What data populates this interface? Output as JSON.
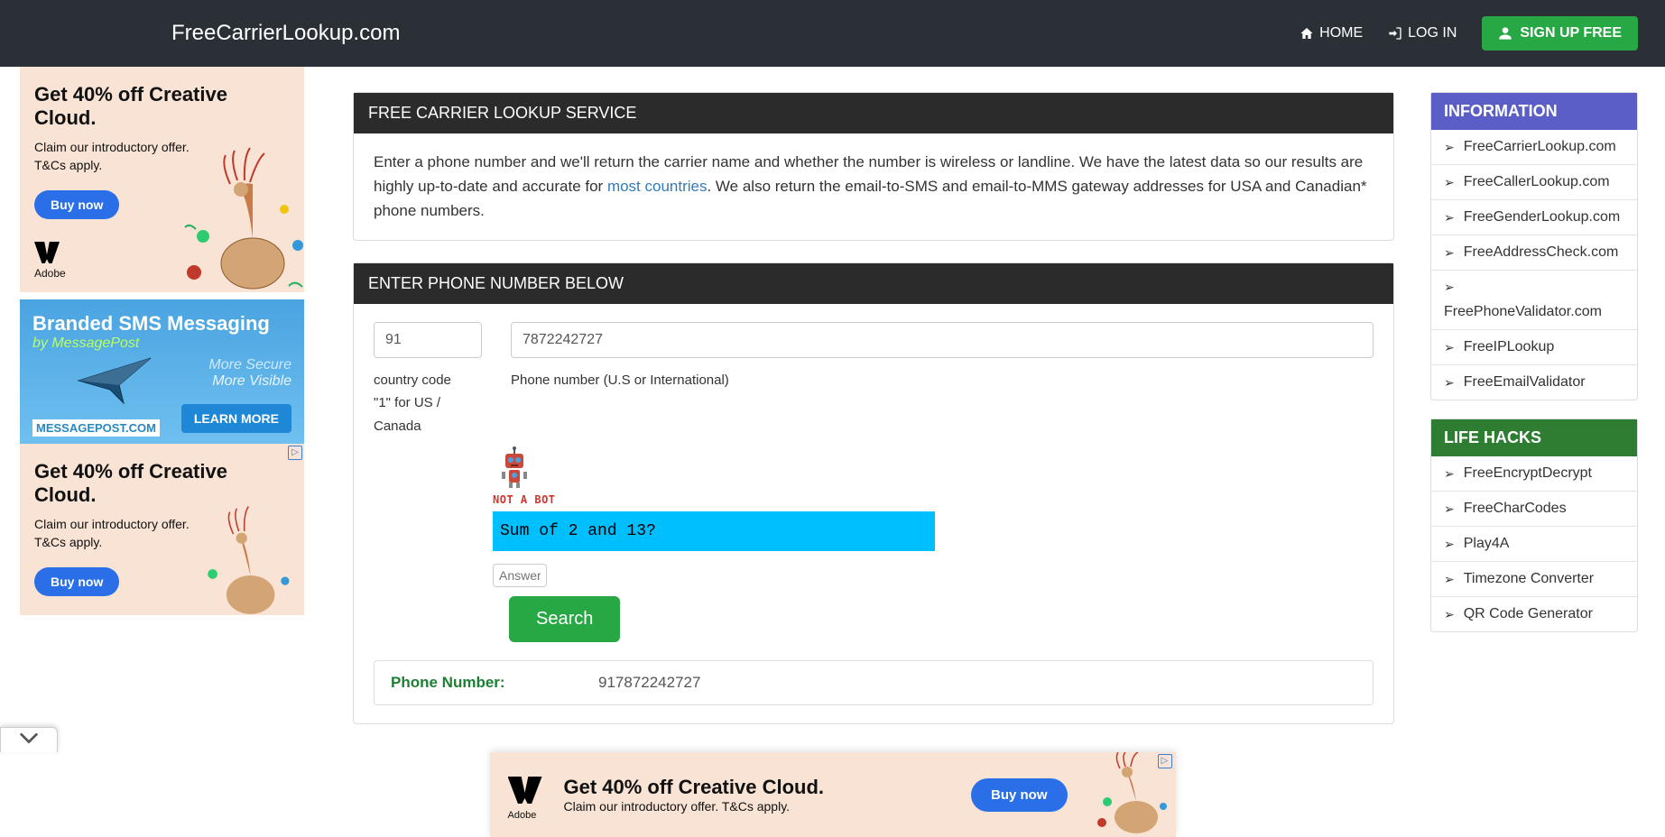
{
  "nav": {
    "brand": "FreeCarrierLookup.com",
    "home": "HOME",
    "login": "LOG IN",
    "signup": "SIGN UP FREE"
  },
  "ads": {
    "creative_cloud": {
      "title": "Get 40% off Creative Cloud.",
      "sub1": "Claim our introductory offer.",
      "sub2": "T&Cs apply.",
      "cta": "Buy now",
      "logo_text": "Adobe"
    },
    "sms": {
      "line1": "Branded SMS Messaging",
      "line2": "by MessagePost",
      "line3": "More Secure",
      "line4": "More Visible",
      "footer": "MESSAGEPOST.COM",
      "cta": "LEARN MORE"
    },
    "bottom": {
      "title": "Get 40% off Creative Cloud.",
      "sub": "Claim our introductory offer. T&Cs apply.",
      "cta": "Buy now",
      "logo_text": "Adobe"
    }
  },
  "main": {
    "service_heading": "FREE CARRIER LOOKUP SERVICE",
    "service_body_1": "Enter a phone number and we'll return the carrier name and whether the number is wireless or landline. We have the latest data so our results are highly up-to-date and accurate for ",
    "service_link": "most countries",
    "service_body_2": ". We also return the email-to-SMS and email-to-MMS gateway addresses for USA and Canadian* phone numbers.",
    "form_heading": "ENTER PHONE NUMBER BELOW",
    "country_code_value": "91",
    "country_code_help1": "country code",
    "country_code_help2": "\"1\" for US / Canada",
    "phone_value": "7872242727",
    "phone_help": "Phone number (U.S or International)",
    "captcha_label": "NOT A BOT",
    "captcha_question": "Sum of 2 and 13?",
    "answer_placeholder": "Answer",
    "search_btn": "Search",
    "result_label": "Phone Number:",
    "result_value": "917872242727"
  },
  "sidebar": {
    "info_heading": "INFORMATION",
    "info_items": [
      "FreeCarrierLookup.com",
      "FreeCallerLookup.com",
      "FreeGenderLookup.com",
      "FreeAddressCheck.com",
      "FreePhoneValidator.com",
      "FreeIPLookup",
      "FreeEmailValidator"
    ],
    "hacks_heading": "LIFE HACKS",
    "hacks_items": [
      "FreeEncryptDecrypt",
      "FreeCharCodes",
      "Play4A",
      "Timezone Converter",
      "QR Code Generator"
    ]
  }
}
